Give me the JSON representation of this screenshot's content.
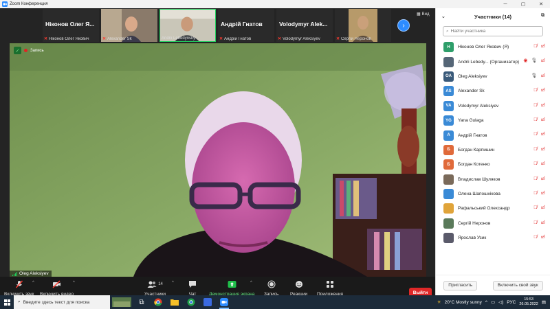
{
  "window": {
    "title": "Zoom Конференция"
  },
  "strip": {
    "tiles": [
      {
        "label": "Ніконов Олег Я...",
        "footer": "Ніконов Олег Якович",
        "muted": true,
        "has_video": false
      },
      {
        "label": "",
        "footer": "Alexander Sk",
        "muted": true,
        "has_video": true
      },
      {
        "label": "",
        "footer": "Andrii Lebedynsky",
        "muted": false,
        "has_video": true
      },
      {
        "label": "Андрій Гнатов",
        "footer": "Андрій Гнатов",
        "muted": true,
        "has_video": false
      },
      {
        "label": "Volodymyr Alek...",
        "footer": "Volodymyr Aleksiyev",
        "muted": true,
        "has_video": false
      },
      {
        "label": "",
        "footer": "Сергій Неронов",
        "muted": true,
        "has_video": true
      }
    ],
    "view_label": "Вид"
  },
  "speaker": {
    "name": "Oleg Aleksiyev",
    "recording_label": "Запись"
  },
  "toolbar": {
    "unmute": "Включить звук",
    "start_video": "Включить видео",
    "participants": "Участники",
    "participants_count": "14",
    "chat": "Чат",
    "share": "Демонстрация экрана",
    "record": "Запись",
    "reactions": "Реакции",
    "apps": "Приложения",
    "leave": "Выйти"
  },
  "panel": {
    "title": "Участники (14)",
    "search_placeholder": "Найти участника",
    "participants": [
      {
        "name": "Ніконов Олег Якович (Я)",
        "avatar": "Н",
        "color": "#2e9e6a",
        "muted": true,
        "video_off": true
      },
      {
        "name": "Andrii Lebedy...  (Организатор)",
        "avatar": "",
        "color": "#556677",
        "muted": false,
        "video_off": true,
        "recording": true
      },
      {
        "name": "Oleg Aleksiyev",
        "avatar": "OA",
        "color": "#3a5a7a",
        "muted": false,
        "video_off": true
      },
      {
        "name": "Alexander Sk",
        "avatar": "AS",
        "color": "#3a8ad6",
        "muted": true,
        "video_off": true
      },
      {
        "name": "Volodymyr Aleksiyev",
        "avatar": "VA",
        "color": "#3a8ad6",
        "muted": true,
        "video_off": true
      },
      {
        "name": "Yana Gulaga",
        "avatar": "YG",
        "color": "#3a8ad6",
        "muted": true,
        "video_off": true
      },
      {
        "name": "Андрій Гнатов",
        "avatar": "A",
        "color": "#3a8ad6",
        "muted": true,
        "video_off": true
      },
      {
        "name": "Богдан Карпишин",
        "avatar": "Б",
        "color": "#e06a3a",
        "muted": true,
        "video_off": true
      },
      {
        "name": "Богдан Котенко",
        "avatar": "Б",
        "color": "#e06a3a",
        "muted": true,
        "video_off": true
      },
      {
        "name": "Владислав Шуляков",
        "avatar": "",
        "color": "#7a6a5a",
        "muted": true,
        "video_off": true
      },
      {
        "name": "Олена Шапошнікова",
        "avatar": "",
        "color": "#3a8ad6",
        "muted": true,
        "video_off": true
      },
      {
        "name": "Рафальський Олександр",
        "avatar": "",
        "color": "#e0a43a",
        "muted": true,
        "video_off": true
      },
      {
        "name": "Сергій Неронов",
        "avatar": "",
        "color": "#5a7a5a",
        "muted": true,
        "video_off": true
      },
      {
        "name": "Ярослав Усик",
        "avatar": "",
        "color": "#5a5a6a",
        "muted": true,
        "video_off": true
      }
    ],
    "invite": "Пригласить",
    "unmute_me": "Включить свой звук"
  },
  "taskbar": {
    "search_placeholder": "Введите здесь текст для поиска",
    "weather": "20°C  Mostly sunny",
    "lang": "РУС",
    "time": "15:53",
    "date": "26.05.2022"
  }
}
